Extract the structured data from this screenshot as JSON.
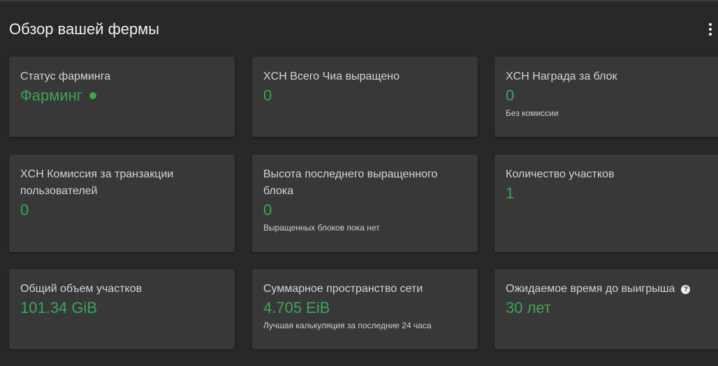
{
  "header": {
    "title": "Обзор вашей фермы",
    "more_icon": "more-vertical-icon"
  },
  "colors": {
    "accent": "#3aa655",
    "background": "#282828",
    "card": "#383838"
  },
  "cards": [
    {
      "title": "Статус фарминга",
      "value": "Фарминг",
      "status_indicator": "green-dot"
    },
    {
      "title": "XCH Всего Чиа выращено",
      "value": "0"
    },
    {
      "title": "XCH Награда за блок",
      "value": "0",
      "caption": "Без комиссии"
    },
    {
      "title": "XCH Комиссия за транзакции пользователей",
      "value": "0"
    },
    {
      "title": "Высота последнего выращенного блока",
      "value": "0",
      "caption": "Выращенных блоков пока нет"
    },
    {
      "title": "Количество участков",
      "value": "1"
    },
    {
      "title": "Общий объем участков",
      "value": "101.34 GiB"
    },
    {
      "title": "Суммарное пространство сети",
      "value": "4.705 EiB",
      "caption": "Лучшая калькуляция за последние 24 часа"
    },
    {
      "title": "Ожидаемое время до выигрыша",
      "value": "30 лет",
      "help_icon": "?"
    }
  ]
}
